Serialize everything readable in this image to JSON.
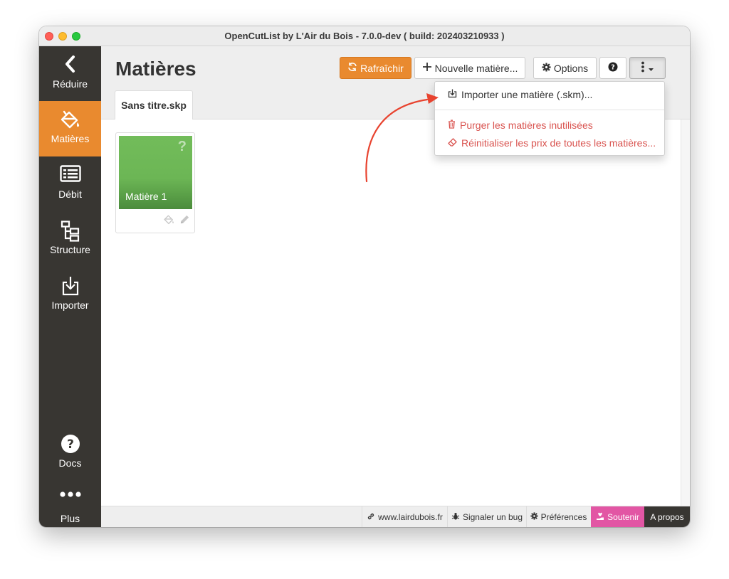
{
  "window": {
    "title": "OpenCutList by L'Air du Bois - 7.0.0-dev ( build: 202403210933 )"
  },
  "sidebar": {
    "items": [
      {
        "label": "Réduire",
        "icon": "chevron-left-icon"
      },
      {
        "label": "Matières",
        "icon": "paint-bucket-icon",
        "active": true
      },
      {
        "label": "Débit",
        "icon": "list-icon"
      },
      {
        "label": "Structure",
        "icon": "tree-icon"
      },
      {
        "label": "Importer",
        "icon": "import-icon"
      },
      {
        "label": "Docs",
        "icon": "question-circle-icon"
      },
      {
        "label": "Plus",
        "icon": "dots-icon"
      }
    ]
  },
  "header": {
    "title": "Matières",
    "buttons": {
      "refresh": "Rafraîchir",
      "new_material": "Nouvelle matière...",
      "options": "Options"
    }
  },
  "tabs": [
    {
      "label": "Sans titre.skp",
      "active": true
    }
  ],
  "materials": [
    {
      "name": "Matière 1",
      "badge": "?",
      "color": "#6cb655"
    }
  ],
  "dropdown": {
    "items": [
      {
        "label": "Importer une matière (.skm)...",
        "color": "#333333"
      },
      {
        "label": "Purger les matières inutilisées",
        "color": "#d9534f"
      },
      {
        "label": "Réinitialiser les prix de toutes les matières...",
        "color": "#d9534f"
      }
    ]
  },
  "footer": {
    "website": "www.lairdubois.fr",
    "bug": "Signaler un bug",
    "preferences": "Préférences",
    "support": "Soutenir",
    "about": "A propos"
  },
  "colors": {
    "accent": "#e98a2f",
    "sidebar": "#383632",
    "danger": "#d9534f",
    "support": "#e256a4",
    "annotation_arrow": "#e8432f"
  }
}
